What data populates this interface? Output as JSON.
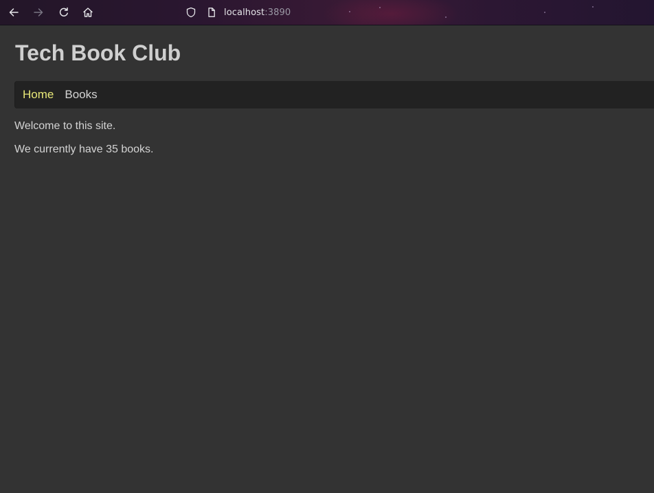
{
  "browser": {
    "url_host": "localhost",
    "url_port": ":3890",
    "icons": [
      "back-arrow-icon",
      "forward-arrow-icon",
      "reload-icon",
      "home-icon",
      "shield-icon",
      "page-icon"
    ]
  },
  "site": {
    "title": "Tech Book Club",
    "nav": [
      {
        "label": "Home",
        "active": true
      },
      {
        "label": "Books",
        "active": false
      }
    ],
    "paragraphs": [
      "Welcome to this site.",
      "We currently have 35 books."
    ]
  },
  "colors": {
    "background": "#333333",
    "nav_background": "#222222",
    "active_link": "#e8e878",
    "text": "#d4d4d4",
    "title": "#cfcfcf"
  }
}
